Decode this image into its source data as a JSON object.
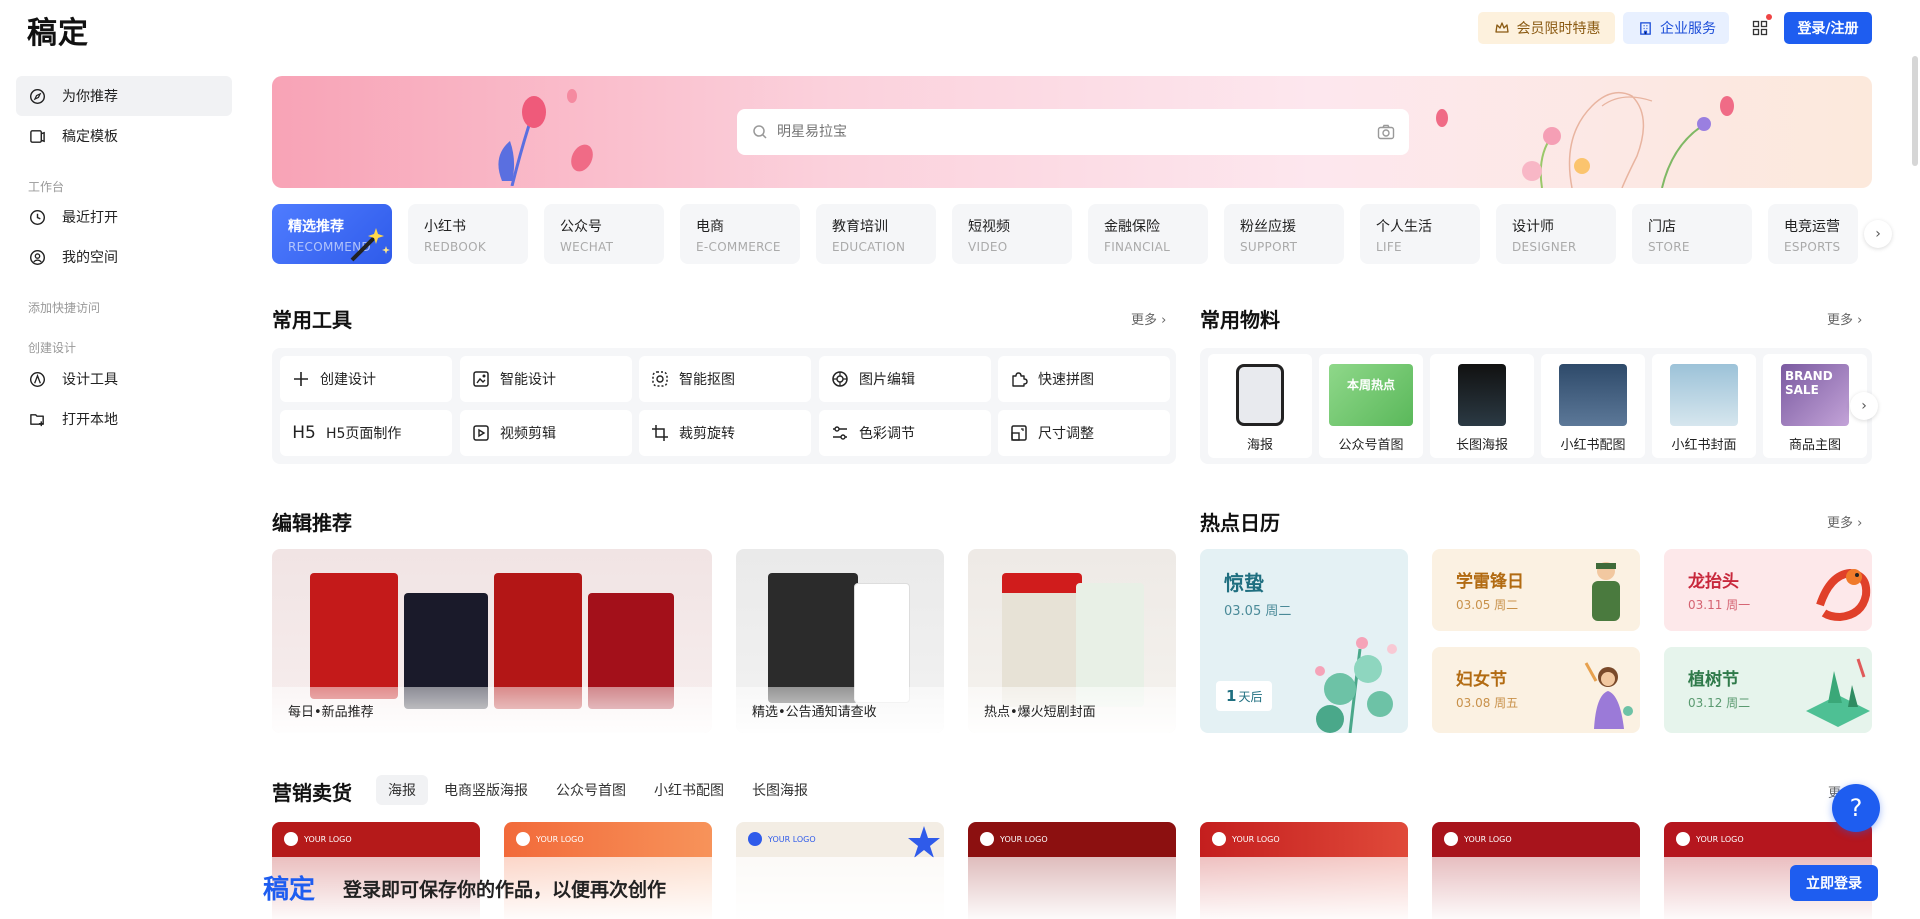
{
  "header": {
    "logo": "稿定",
    "vip_label": "会员限时特惠",
    "enterprise_label": "企业服务",
    "login_label": "登录/注册"
  },
  "sidebar": {
    "items": [
      {
        "label": "为你推荐",
        "icon": "compass-icon"
      },
      {
        "label": "稿定模板",
        "icon": "template-icon"
      }
    ],
    "group_workspace": "工作台",
    "workspace_items": [
      {
        "label": "最近打开",
        "icon": "clock-icon"
      },
      {
        "label": "我的空间",
        "icon": "user-circle-icon"
      }
    ],
    "group_quick": "添加快捷访问",
    "group_create": "创建设计",
    "create_items": [
      {
        "label": "设计工具",
        "icon": "pen-icon"
      },
      {
        "label": "打开本地",
        "icon": "folder-add-icon"
      }
    ]
  },
  "search": {
    "placeholder": "明星易拉宝"
  },
  "categories": [
    {
      "title": "精选推荐",
      "en": "RECOMMEND"
    },
    {
      "title": "小红书",
      "en": "REDBOOK"
    },
    {
      "title": "公众号",
      "en": "WECHAT"
    },
    {
      "title": "电商",
      "en": "E-COMMERCE"
    },
    {
      "title": "教育培训",
      "en": "EDUCATION"
    },
    {
      "title": "短视频",
      "en": "VIDEO"
    },
    {
      "title": "金融保险",
      "en": "FINANCIAL"
    },
    {
      "title": "粉丝应援",
      "en": "SUPPORT"
    },
    {
      "title": "个人生活",
      "en": "LIFE"
    },
    {
      "title": "设计师",
      "en": "DESIGNER"
    },
    {
      "title": "门店",
      "en": "STORE"
    },
    {
      "title": "电竞运营",
      "en": "ESPORTS"
    }
  ],
  "tools": {
    "title": "常用工具",
    "more": "更多",
    "items": [
      {
        "label": "创建设计",
        "icon": "plus-icon"
      },
      {
        "label": "智能设计",
        "icon": "ai-design-icon"
      },
      {
        "label": "智能抠图",
        "icon": "cutout-icon"
      },
      {
        "label": "图片编辑",
        "icon": "image-edit-icon"
      },
      {
        "label": "快速拼图",
        "icon": "puzzle-icon"
      },
      {
        "label": "H5页面制作",
        "icon": "h5-icon"
      },
      {
        "label": "视频剪辑",
        "icon": "video-icon"
      },
      {
        "label": "裁剪旋转",
        "icon": "crop-icon"
      },
      {
        "label": "色彩调节",
        "icon": "sliders-icon"
      },
      {
        "label": "尺寸调整",
        "icon": "resize-icon"
      }
    ]
  },
  "materials": {
    "title": "常用物料",
    "more": "更多",
    "items": [
      {
        "label": "海报",
        "color": "#3a3a3a"
      },
      {
        "label": "公众号首图",
        "color": "#6cc36a"
      },
      {
        "label": "长图海报",
        "color": "#1f2b33"
      },
      {
        "label": "小红书配图",
        "color": "#314866"
      },
      {
        "label": "小红书封面",
        "color": "#a8c6d8"
      },
      {
        "label": "商品主图",
        "color": "#6a4a8c"
      }
    ],
    "thumb_texts": {
      "m2": "本周热点",
      "m6": "BRAND SALE"
    }
  },
  "editor": {
    "title": "编辑推荐",
    "items": [
      {
        "caption": "每日•新品推荐"
      },
      {
        "caption": "精选•公告通知请查收"
      },
      {
        "caption": "热点•爆火短剧封面"
      }
    ]
  },
  "calendar": {
    "title": "热点日历",
    "more": "更多",
    "main": {
      "name": "惊蛰",
      "date": "03.05 周二",
      "days": "1",
      "days_suffix": "天后"
    },
    "items": [
      {
        "name": "学雷锋日",
        "date": "03.05 周二"
      },
      {
        "name": "龙抬头",
        "date": "03.11 周一"
      },
      {
        "name": "妇女节",
        "date": "03.08 周五"
      },
      {
        "name": "植树节",
        "date": "03.12 周二"
      }
    ]
  },
  "marketing": {
    "title": "营销卖货",
    "more": "更多",
    "tabs": [
      "海报",
      "电商竖版海报",
      "公众号首图",
      "小红书配图",
      "长图海报"
    ],
    "logo_text": "YOUR LOGO"
  },
  "bottom": {
    "logo": "稿定",
    "text": "登录即可保存你的作品，以便再次创作",
    "button": "立即登录"
  },
  "help": "?",
  "colors": {
    "primary": "#1e5df0",
    "vip_bg": "#fdf1dd",
    "enterprise_bg": "#e8f0ff"
  }
}
